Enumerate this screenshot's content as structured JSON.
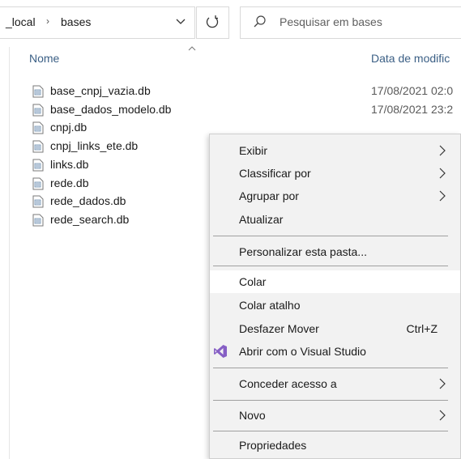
{
  "address_bar": {
    "breadcrumb_parent": "_local",
    "breadcrumb_current": "bases"
  },
  "search": {
    "placeholder": "Pesquisar em bases"
  },
  "columns": {
    "name": "Nome",
    "date": "Data de modific"
  },
  "files": [
    {
      "name": "base_cnpj_vazia.db",
      "date": "17/08/2021 02:0"
    },
    {
      "name": "base_dados_modelo.db",
      "date": "17/08/2021 23:2"
    },
    {
      "name": "cnpj.db",
      "date": ""
    },
    {
      "name": "cnpj_links_ete.db",
      "date": ""
    },
    {
      "name": "links.db",
      "date": ""
    },
    {
      "name": "rede.db",
      "date": ""
    },
    {
      "name": "rede_dados.db",
      "date": ""
    },
    {
      "name": "rede_search.db",
      "date": ""
    }
  ],
  "context_menu": {
    "exibir": "Exibir",
    "classificar": "Classificar por",
    "agrupar": "Agrupar por",
    "atualizar": "Atualizar",
    "personalizar": "Personalizar esta pasta...",
    "colar": "Colar",
    "colar_atalho": "Colar atalho",
    "desfazer": "Desfazer Mover",
    "desfazer_shortcut": "Ctrl+Z",
    "abrir_vs": "Abrir com o Visual Studio",
    "conceder": "Conceder acesso a",
    "novo": "Novo",
    "propriedades": "Propriedades"
  },
  "colors": {
    "header_text": "#3b5f85",
    "menu_bg": "#f2f2f2",
    "menu_hover": "#ffffff",
    "vs_purple": "#865fc5"
  }
}
